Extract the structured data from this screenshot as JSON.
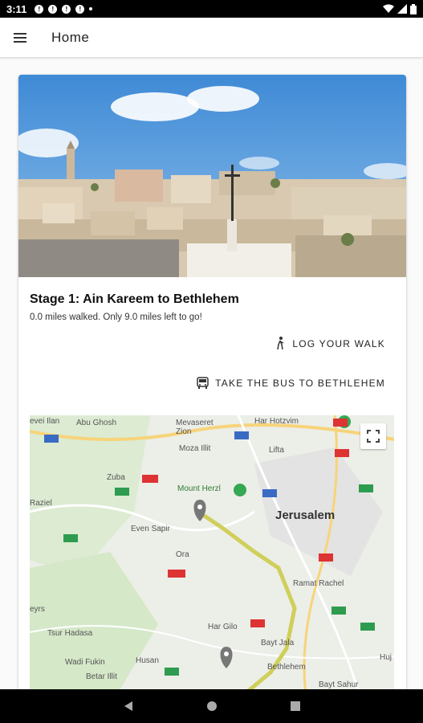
{
  "status": {
    "time": "3:11"
  },
  "appbar": {
    "title": "Home"
  },
  "stage": {
    "title": "Stage 1: Ain Kareem to Bethlehem",
    "progress": "0.0 miles walked. Only 9.0 miles left to go!",
    "log_walk_label": "LOG YOUR WALK",
    "bus_label": "TAKE THE BUS TO BETHLEHEM"
  },
  "map": {
    "labels": {
      "beitnan": "evei Ilan",
      "abughosh": "Abu Ghosh",
      "mevaseret": "Mevaseret Zion",
      "harhotzvim": "Har Hotzvim",
      "moza": "Moza Illit",
      "lifta": "Lifta",
      "zuba": "Zuba",
      "mountherzl": "Mount Herzl",
      "raziel": "Raziel",
      "evensapir": "Even Sapir",
      "jerusalem": "Jerusalem",
      "ora": "Ora",
      "ramatrachel": "Ramat Rachel",
      "tsurhadasa": "Tsur Hadasa",
      "hargilo": "Har Gilo",
      "baytjala": "Bayt Jala",
      "wadifukin": "Wadi Fukin",
      "husan": "Husan",
      "betarillit": "Betar Illit",
      "bethlehem": "Bethlehem",
      "baytsahur": "Bayt Sahur",
      "ramot": "eyrs",
      "huj": "Huj"
    }
  }
}
